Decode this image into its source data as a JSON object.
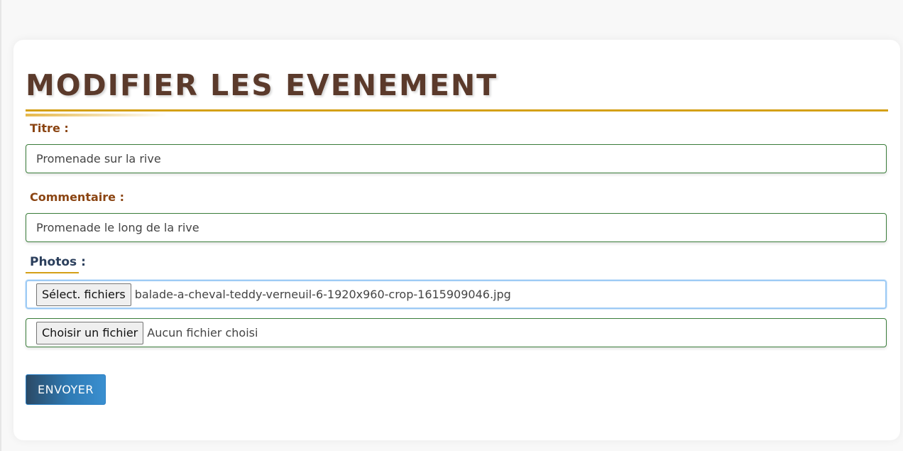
{
  "form": {
    "heading": "MODIFIER LES EVENEMENT",
    "titre": {
      "label": "Titre :",
      "value": "Promenade sur la rive"
    },
    "commentaire": {
      "label": "Commentaire :",
      "value": "Promenade le long de la rive"
    },
    "photos": {
      "label": "Photos :",
      "files": [
        {
          "button_label": "Sélect. fichiers",
          "file_name": "balade-a-cheval-teddy-verneuil-6-1920x960-crop-1615909046.jpg"
        },
        {
          "button_label": "Choisir un fichier",
          "file_name": "Aucun fichier choisi"
        }
      ]
    },
    "submit_label": "ENVOYER"
  },
  "colors": {
    "heading": "#5b3a2b",
    "accent_gold": "#d4a017",
    "label_brown": "#8b4513",
    "label_blue": "#2b3f5c",
    "field_border": "#3a7d3a",
    "focus_border": "#9ecbf5",
    "button_blue": "#2f7bb5"
  }
}
